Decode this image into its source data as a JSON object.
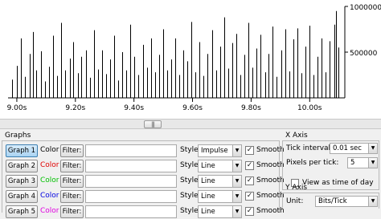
{
  "chart_data": {
    "type": "bar",
    "style": "impulse",
    "x_unit": "s",
    "x_ticks": [
      "9.00s",
      "9.20s",
      "9.40s",
      "9.60s",
      "9.80s",
      "10.00s"
    ],
    "x_tick_values": [
      9.0,
      9.2,
      9.4,
      9.6,
      9.8,
      10.0
    ],
    "xlim": [
      8.97,
      10.12
    ],
    "y_ticks": [
      "1000000",
      "500000"
    ],
    "y_tick_values": [
      1000000,
      500000
    ],
    "ylim": [
      0,
      1000000
    ],
    "grid": false,
    "series": [
      {
        "x": [
          8.985,
          9.0,
          9.013,
          9.027,
          9.043,
          9.055,
          9.067,
          9.083,
          9.097,
          9.11,
          9.125,
          9.138,
          9.151,
          9.166,
          9.18,
          9.193,
          9.209,
          9.221,
          9.235,
          9.25,
          9.263,
          9.277,
          9.291,
          9.305,
          9.319,
          9.333,
          9.346,
          9.36,
          9.374,
          9.388,
          9.402,
          9.416,
          9.43,
          9.444,
          9.458,
          9.471,
          9.485,
          9.499,
          9.513,
          9.527,
          9.541,
          9.555,
          9.569,
          9.583,
          9.597,
          9.61,
          9.624,
          9.638,
          9.652,
          9.666,
          9.68,
          9.694,
          9.708,
          9.722,
          9.735,
          9.749,
          9.763,
          9.777,
          9.791,
          9.805,
          9.819,
          9.833,
          9.847,
          9.86,
          9.874,
          9.888,
          9.902,
          9.916,
          9.93,
          9.944,
          9.958,
          9.972,
          9.985,
          9.999,
          10.013,
          10.027,
          10.041,
          10.055,
          10.069,
          10.083,
          10.09,
          10.097
        ],
        "values": [
          200000,
          350000,
          650000,
          230000,
          480000,
          720000,
          300000,
          510000,
          180000,
          340000,
          680000,
          240000,
          820000,
          300000,
          430000,
          610000,
          270000,
          450000,
          520000,
          220000,
          740000,
          310000,
          520000,
          260000,
          420000,
          680000,
          190000,
          500000,
          300000,
          800000,
          450000,
          250000,
          580000,
          330000,
          650000,
          280000,
          470000,
          750000,
          300000,
          420000,
          650000,
          250000,
          520000,
          400000,
          830000,
          280000,
          610000,
          240000,
          480000,
          740000,
          300000,
          560000,
          880000,
          320000,
          600000,
          700000,
          250000,
          470000,
          820000,
          330000,
          540000,
          690000,
          280000,
          480000,
          780000,
          230000,
          520000,
          750000,
          290000,
          640000,
          760000,
          270000,
          560000,
          790000,
          250000,
          450000,
          650000,
          280000,
          620000,
          800000,
          950000,
          550000
        ]
      }
    ]
  },
  "scrollbar": {
    "thumb_glyph": "|||"
  },
  "graphs_panel": {
    "title": "Graphs",
    "rows": [
      {
        "button": "Graph 1",
        "color_label": "Color",
        "color": "#000000",
        "filter_label": "Filter:",
        "filter_value": "",
        "style_label": "Style:",
        "style_value": "Impulse",
        "smooth_checked": true,
        "smooth_label": "Smooth",
        "active": true
      },
      {
        "button": "Graph 2",
        "color_label": "Color",
        "color": "#e00000",
        "filter_label": "Filter:",
        "filter_value": "",
        "style_label": "Style:",
        "style_value": "Line",
        "smooth_checked": true,
        "smooth_label": "Smooth",
        "active": false
      },
      {
        "button": "Graph 3",
        "color_label": "Color",
        "color": "#00c000",
        "filter_label": "Filter:",
        "filter_value": "",
        "style_label": "Style:",
        "style_value": "Line",
        "smooth_checked": true,
        "smooth_label": "Smooth",
        "active": false
      },
      {
        "button": "Graph 4",
        "color_label": "Color",
        "color": "#0000e0",
        "filter_label": "Filter:",
        "filter_value": "",
        "style_label": "Style:",
        "style_value": "Line",
        "smooth_checked": true,
        "smooth_label": "Smooth",
        "active": false
      },
      {
        "button": "Graph 5",
        "color_label": "Color",
        "color": "#e000e0",
        "filter_label": "Filter:",
        "filter_value": "",
        "style_label": "Style:",
        "style_value": "Line",
        "smooth_checked": true,
        "smooth_label": "Smooth",
        "active": false
      }
    ]
  },
  "x_axis_panel": {
    "title": "X Axis",
    "tick_interval_label": "Tick interval:",
    "tick_interval_value": "0.01 sec",
    "pixels_per_tick_label": "Pixels per tick:",
    "pixels_per_tick_value": "5",
    "view_as_time_label": "View as time of day",
    "view_as_time_checked": false
  },
  "y_axis_panel": {
    "title": "Y Axis",
    "unit_label": "Unit:",
    "unit_value": "Bits/Tick"
  }
}
